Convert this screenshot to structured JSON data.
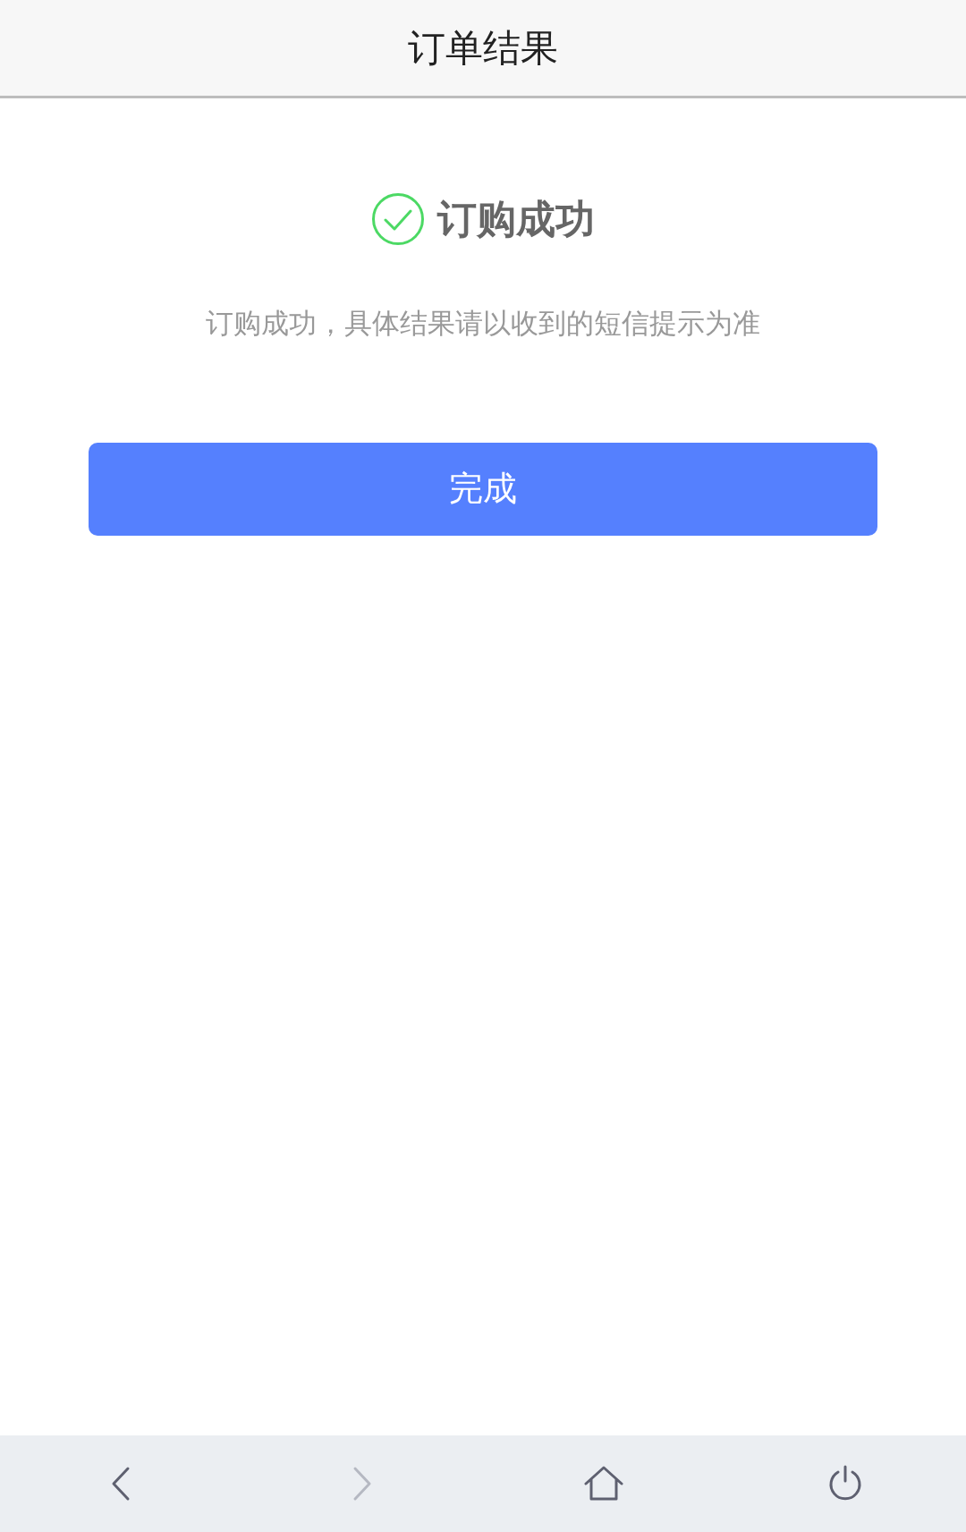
{
  "header": {
    "title": "订单结果"
  },
  "result": {
    "succeeded": true,
    "title": "订购成功",
    "message": "订购成功，具体结果请以收到的短信提示为准"
  },
  "primary_button": {
    "label": "完成"
  },
  "toolbar": [
    {
      "kind": "back",
      "disabled": false
    },
    {
      "kind": "forward",
      "disabled": true
    },
    {
      "kind": "home",
      "disabled": false
    },
    {
      "kind": "power",
      "disabled": false
    }
  ]
}
